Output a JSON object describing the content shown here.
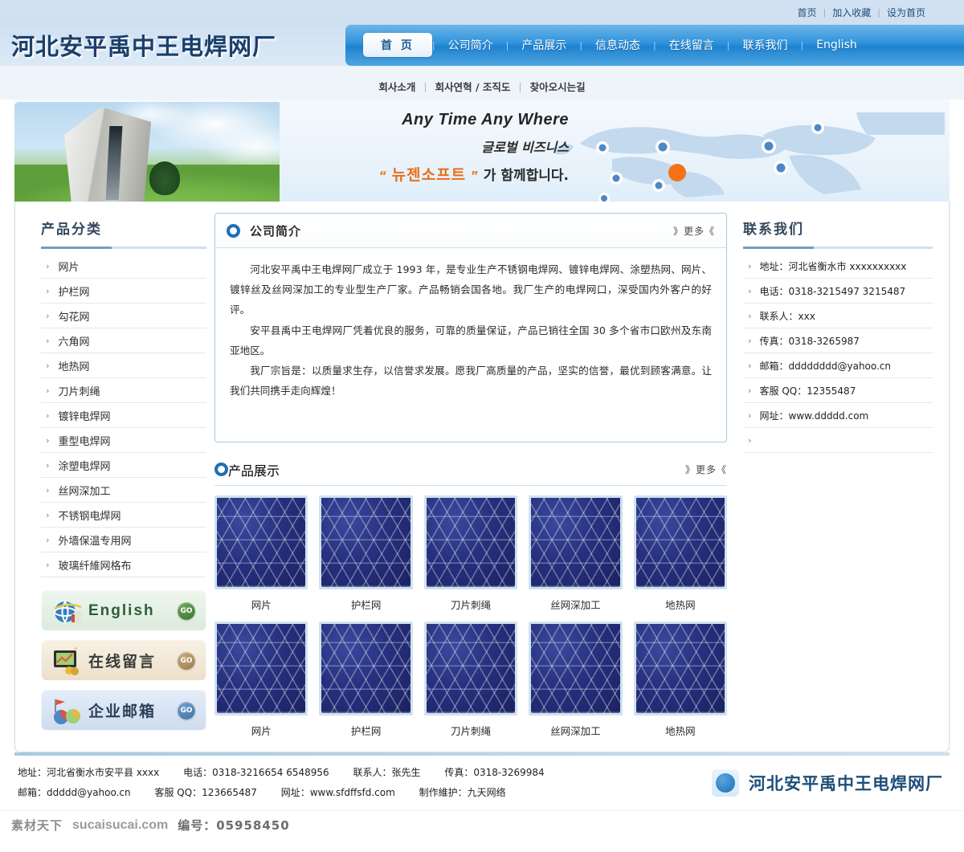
{
  "toplinks": [
    {
      "label": "首页"
    },
    {
      "label": "加入收藏"
    },
    {
      "label": "设为首页"
    }
  ],
  "header": {
    "logo_text": "河北安平禹中王电焊网厂",
    "nav": [
      {
        "label": "首 页",
        "active": true
      },
      {
        "label": "公司简介",
        "active": false
      },
      {
        "label": "产品展示",
        "active": false
      },
      {
        "label": "信息动态",
        "active": false
      },
      {
        "label": "在线留言",
        "active": false
      },
      {
        "label": "联系我们",
        "active": false
      },
      {
        "label": "English",
        "active": false
      }
    ]
  },
  "subnav": [
    {
      "label": "회사소개"
    },
    {
      "label": "회사연혁 / 조직도"
    },
    {
      "label": "찾아오시는길"
    }
  ],
  "banner": {
    "line1": "Any Time Any Where",
    "line2": "글로벌 비즈니스",
    "quote_open": "“",
    "brand": "뉴젠소프트",
    "quote_close": "”",
    "line3_tail": "가 함께합니다.",
    "accent_color": "#e8701a",
    "map_marker_color": "#f47316"
  },
  "sidebar": {
    "title": "产品分类",
    "categories": [
      {
        "label": "网片"
      },
      {
        "label": "护栏网"
      },
      {
        "label": "勾花网"
      },
      {
        "label": "六角网"
      },
      {
        "label": "地热网"
      },
      {
        "label": "刀片刺绳"
      },
      {
        "label": "镀锌电焊网"
      },
      {
        "label": "重型电焊网"
      },
      {
        "label": "涂塑电焊网"
      },
      {
        "label": "丝网深加工"
      },
      {
        "label": "不锈钢电焊网"
      },
      {
        "label": "外墙保温专用网"
      },
      {
        "label": "玻璃纤維网格布"
      }
    ],
    "buttons": [
      {
        "label": "English",
        "go": "GO",
        "theme": "green"
      },
      {
        "label": "在线留言",
        "go": "GO",
        "theme": "tan"
      },
      {
        "label": "企业邮箱",
        "go": "GO",
        "theme": "blue"
      }
    ]
  },
  "about": {
    "title": "公司简介",
    "more": "》更多《",
    "paragraphs": [
      "河北安平禹中王电焊网厂成立于 1993 年，是专业生产不锈钢电焊网、镀锌电焊网、涂塑热网、网片、镀锌丝及丝网深加工的专业型生产厂家。产品畅销会国各地。我厂生产的电焊网口，深受国内外客户的好评。",
      "安平县禹中王电焊网厂凭着优良的服务，可靠的质量保证，产品已销往全国 30 多个省市口欧州及东南亚地区。",
      "我厂宗旨是：以质量求生存，以信誉求发展。愿我厂高质量的产品，坚实的信誉，最优到顾客满意。让我们共同携手走向辉煌！"
    ]
  },
  "products": {
    "title": "产品展示",
    "more": "》更多《",
    "row1": [
      {
        "caption": "网片"
      },
      {
        "caption": "护栏网"
      },
      {
        "caption": "刀片刺绳"
      },
      {
        "caption": "丝网深加工"
      },
      {
        "caption": "地热网"
      }
    ],
    "row2": [
      {
        "caption": "网片"
      },
      {
        "caption": "护栏网"
      },
      {
        "caption": "刀片刺绳"
      },
      {
        "caption": "丝网深加工"
      },
      {
        "caption": "地热网"
      }
    ]
  },
  "contact": {
    "title": "联系我们",
    "items": [
      {
        "label": "地址：河北省衡水市 xxxxxxxxxx"
      },
      {
        "label": "电话：0318-3215497  3215487"
      },
      {
        "label": "联系人：xxx"
      },
      {
        "label": "传真：0318-3265987"
      },
      {
        "label": "邮箱：dddddddd@yahoo.cn"
      },
      {
        "label": "客服 QQ：12355487"
      },
      {
        "label": "网址：www.ddddd.com"
      },
      {
        "label": ""
      }
    ]
  },
  "footer": {
    "line1": {
      "address": "地址：河北省衡水市安平县 xxxx",
      "phone": "电话：0318-3216654  6548956",
      "person": "联系人：张先生",
      "fax": "传真：0318-3269984"
    },
    "line2": {
      "email": "邮箱：ddddd@yahoo.cn",
      "qq": "客服 QQ：123665487",
      "site": "网址：www.sfdffsfd.com",
      "maker": "制作維护：九天网络"
    },
    "logo_text": "河北安平禹中王电焊网厂"
  },
  "watermark": {
    "cn": "素材天下",
    "url": "sucaisucai.com",
    "no": "编号：05958450"
  }
}
